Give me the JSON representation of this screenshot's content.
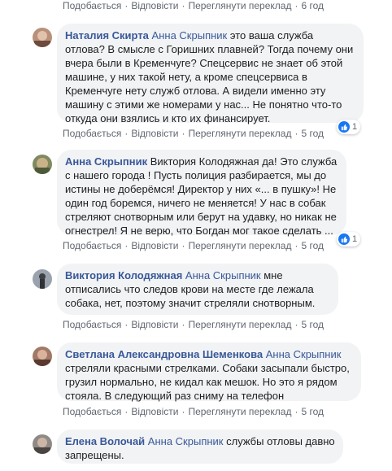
{
  "actions": {
    "like": "Подобається",
    "reply": "Відповісти",
    "translate": "Переглянути переклад",
    "separator": "·"
  },
  "top_time": "6 год",
  "comments": [
    {
      "author": "Наталия Скирта",
      "mention": "Анна Скрыпник",
      "text": " это ваша служба отлова? В смысле с Горишних плавней? Тогда почему они вчера были в Кременчуге? Спецсервис не знает об этой машине, у них такой нету, а кроме спецсервиса в Кременчуге нету служб отлова. А видели именно эту машину с этими же номерами у нас... Не понятно что-то откуда они взялись и кто их финансирует.",
      "time": "5 год",
      "reactions": "1"
    },
    {
      "author": "Анна Скрыпник",
      "mention": "",
      "text": " Виктория Колодяжная да! Это служба с нашего города ! Пусть полиция разбирается, мы до истины не доберёмся! Директор у них «... в пушку»! Не один год боремся, ничего не меняется! У нас в собак стреляют снотворным или берут на удавку, но никак не огнестрел! Я не верю, что Богдан мог такое сделать ...",
      "time": "5 год",
      "reactions": "1"
    },
    {
      "author": "Виктория Колодяжная",
      "mention": "Анна Скрыпник",
      "text": " мне отписались что следов крови на месте где лежала собака, нет, поэтому значит стреляли снотворным.",
      "time": "5 год",
      "reactions": ""
    },
    {
      "author": "Светлана Александровна Шеменкова",
      "mention": "Анна Скрыпник",
      "text": " стреляли красными стрелками. Собаки засыпали быстро, грузил нормально, не кидал как мешок. Но это я рядом стояла. В следующий раз сниму на телефон",
      "time": "5 год",
      "reactions": ""
    },
    {
      "author": "Елена Волочай",
      "mention": "Анна Скрыпник",
      "text": " службы отловы давно запрещены.",
      "time": "",
      "reactions": ""
    }
  ]
}
